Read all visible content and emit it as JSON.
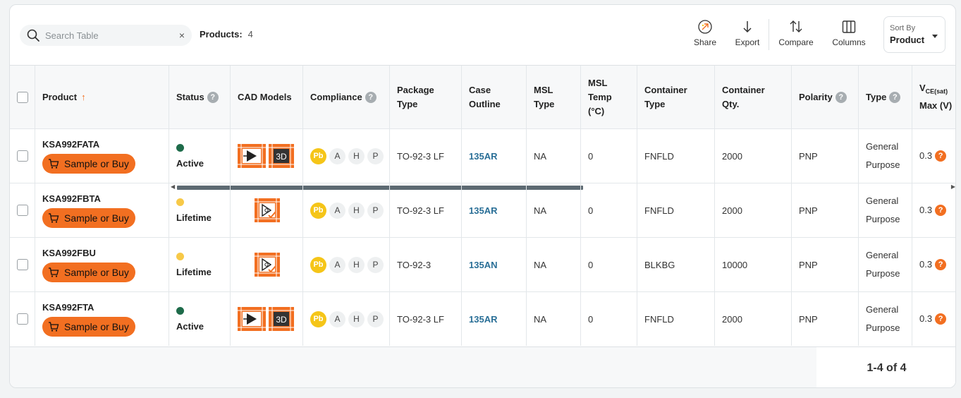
{
  "toolbar": {
    "search_placeholder": "Search Table",
    "clear_symbol": "×",
    "products_label": "Products:",
    "products_count": "4",
    "share": "Share",
    "export": "Export",
    "compare": "Compare",
    "columns": "Columns",
    "sort_by_label": "Sort By",
    "sort_by_value": "Product"
  },
  "columns": {
    "product": "Product",
    "status": "Status",
    "cad": "CAD Models",
    "compliance": "Compliance",
    "package_l1": "Package",
    "package_l2": "Type",
    "case_l1": "Case",
    "case_l2": "Outline",
    "msl_l1": "MSL",
    "msl_l2": "Type",
    "msltemp_l1": "MSL",
    "msltemp_l2": "Temp",
    "msltemp_l3": "(°C)",
    "container_l1": "Container",
    "container_l2": "Type",
    "qty_l1": "Container",
    "qty_l2": "Qty.",
    "polarity": "Polarity",
    "type": "Type",
    "vce_main": "V",
    "vce_sub": "CE(sat)",
    "vce_l2": "Max (V)"
  },
  "help_symbol": "?",
  "sort_arrow": "↑",
  "buy_label": "Sample or Buy",
  "compliance_badges": {
    "pb": "Pb",
    "a": "A",
    "h": "H",
    "p": "P"
  },
  "cad_3d_label": "3D",
  "colors": {
    "accent": "#f26f21",
    "active": "#1e6b4a",
    "lifetime": "#f7c948",
    "link": "#2a6f97"
  },
  "rows": [
    {
      "product": "KSA992FATA",
      "status": "Active",
      "cad": "symbol+3d",
      "package": "TO-92-3 LF",
      "case": "135AR",
      "msl": "NA",
      "msl_temp": "0",
      "container": "FNFLD",
      "qty": "2000",
      "polarity": "PNP",
      "type_l1": "General",
      "type_l2": "Purpose",
      "vce": "0.3"
    },
    {
      "product": "KSA992FBTA",
      "status": "Lifetime",
      "cad": "verified",
      "package": "TO-92-3 LF",
      "case": "135AR",
      "msl": "NA",
      "msl_temp": "0",
      "container": "FNFLD",
      "qty": "2000",
      "polarity": "PNP",
      "type_l1": "General",
      "type_l2": "Purpose",
      "vce": "0.3"
    },
    {
      "product": "KSA992FBU",
      "status": "Lifetime",
      "cad": "verified",
      "package": "TO-92-3",
      "case": "135AN",
      "msl": "NA",
      "msl_temp": "0",
      "container": "BLKBG",
      "qty": "10000",
      "polarity": "PNP",
      "type_l1": "General",
      "type_l2": "Purpose",
      "vce": "0.3"
    },
    {
      "product": "KSA992FTA",
      "status": "Active",
      "cad": "symbol+3d",
      "package": "TO-92-3 LF",
      "case": "135AR",
      "msl": "NA",
      "msl_temp": "0",
      "container": "FNFLD",
      "qty": "2000",
      "polarity": "PNP",
      "type_l1": "General",
      "type_l2": "Purpose",
      "vce": "0.3"
    }
  ],
  "pager": "1-4 of 4"
}
